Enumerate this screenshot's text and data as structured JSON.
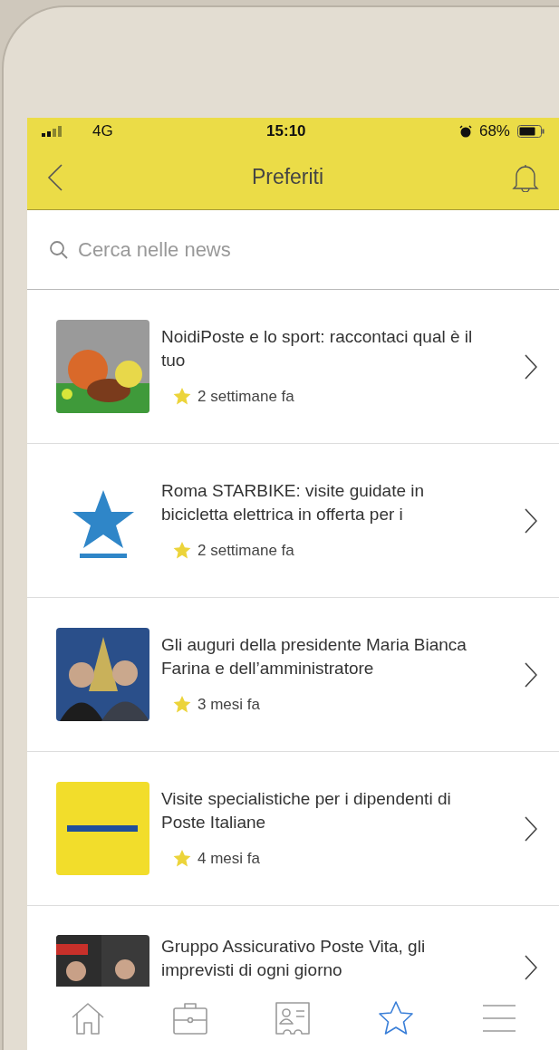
{
  "status_bar": {
    "network": "4G",
    "time": "15:10",
    "battery": "68%"
  },
  "header": {
    "title": "Preferiti"
  },
  "search": {
    "placeholder": "Cerca nelle news"
  },
  "news": [
    {
      "title": "NoidiPoste e lo sport: raccontaci qual è il tuo",
      "time": "2 settimane fa"
    },
    {
      "title": "Roma STARBIKE: visite guidate in bicicletta elettrica in offerta per i",
      "time": "2 settimane fa"
    },
    {
      "title": "Gli auguri della presidente Maria Bianca Farina e dell’amministratore",
      "time": "3 mesi fa"
    },
    {
      "title": "Visite specialistiche per i dipendenti di Poste Italiane",
      "time": "4 mesi fa"
    },
    {
      "title": "Gruppo Assicurativo Poste Vita, gli imprevisti di ogni giorno"
    }
  ],
  "tabs": [
    {
      "kind": "home",
      "selected": false
    },
    {
      "kind": "work",
      "selected": false
    },
    {
      "kind": "contact",
      "selected": false
    },
    {
      "kind": "favorites",
      "selected": true
    },
    {
      "kind": "menu",
      "selected": false
    }
  ]
}
